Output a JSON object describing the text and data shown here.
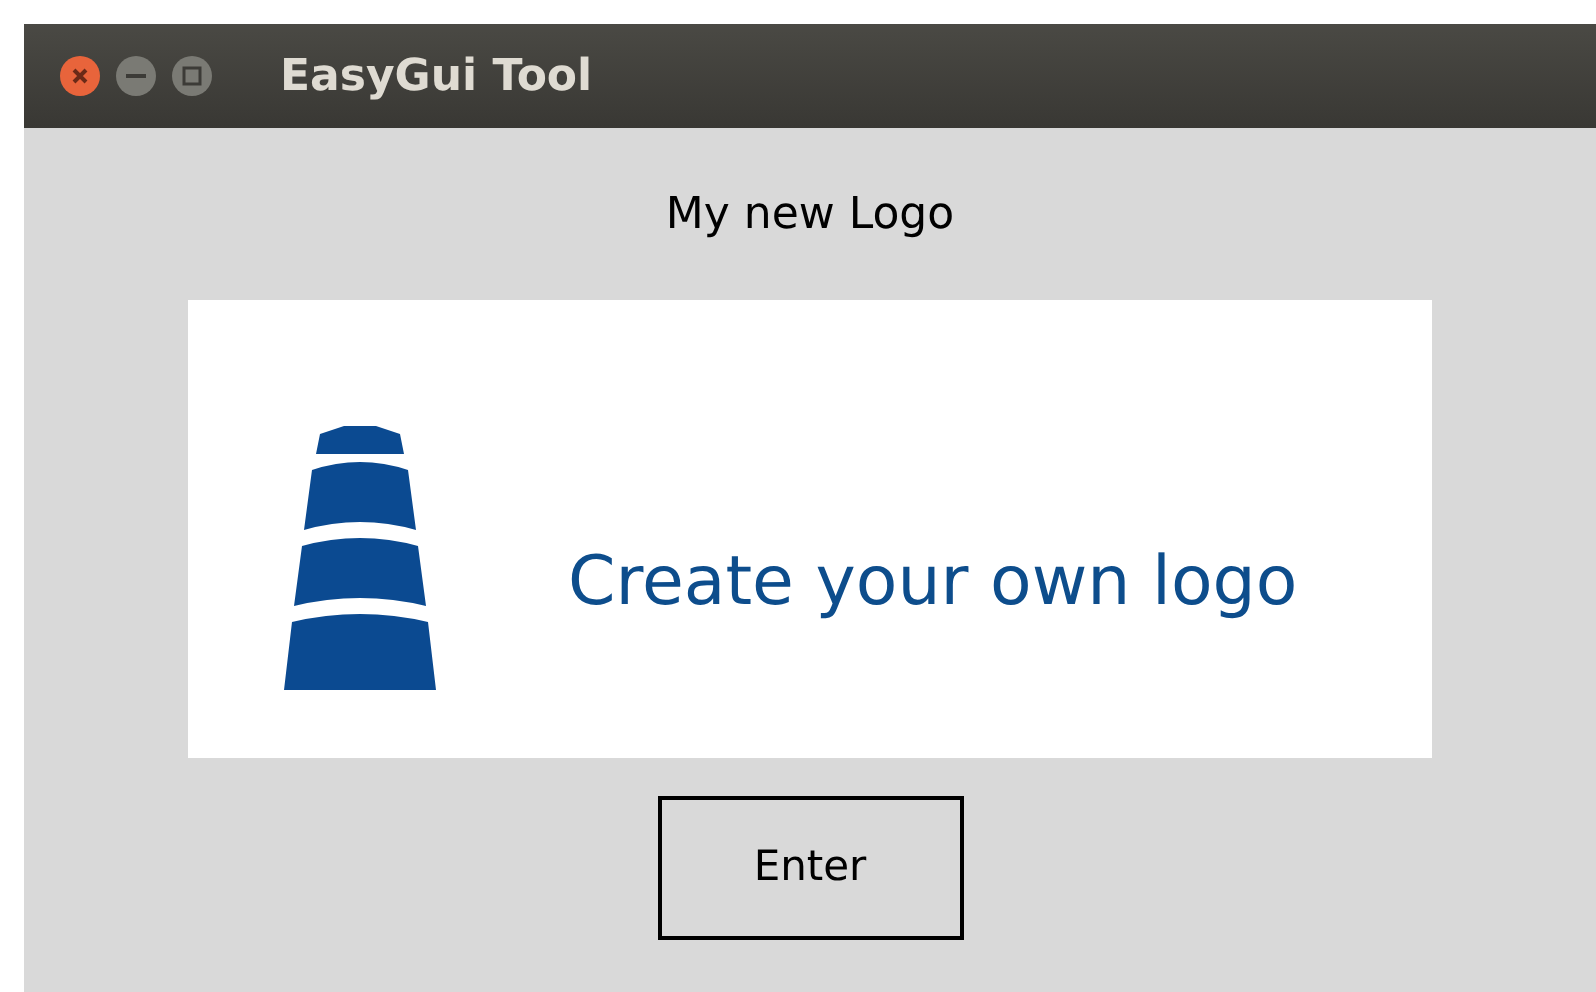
{
  "window": {
    "title": "EasyGui Tool"
  },
  "heading": "My new Logo",
  "logo": {
    "text": "Create your own logo"
  },
  "buttons": [
    {
      "label": "Enter"
    }
  ]
}
